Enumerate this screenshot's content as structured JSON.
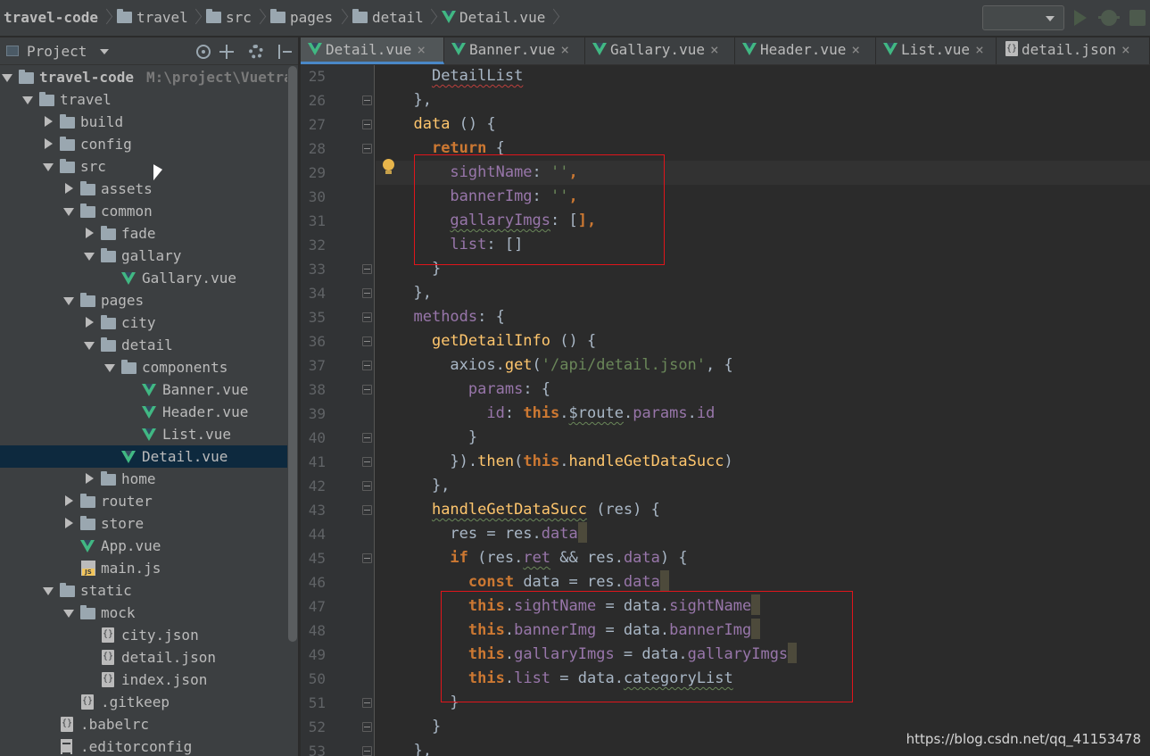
{
  "breadcrumb": [
    {
      "label": "travel-code",
      "icon": "none"
    },
    {
      "label": "travel",
      "icon": "folder-icon"
    },
    {
      "label": "src",
      "icon": "folder-icon"
    },
    {
      "label": "pages",
      "icon": "folder-icon"
    },
    {
      "label": "detail",
      "icon": "folder-icon"
    },
    {
      "label": "Detail.vue",
      "icon": "vue-icon"
    }
  ],
  "project": {
    "title": "Project",
    "tree": [
      {
        "label": "travel-code",
        "path": "M:\\project\\Vuetra",
        "depth": 0,
        "type": "folder",
        "open": true,
        "bold": true
      },
      {
        "label": "travel",
        "depth": 1,
        "type": "folder",
        "open": true
      },
      {
        "label": "build",
        "depth": 2,
        "type": "folder",
        "open": false
      },
      {
        "label": "config",
        "depth": 2,
        "type": "folder",
        "open": false
      },
      {
        "label": "src",
        "depth": 2,
        "type": "folder",
        "open": true
      },
      {
        "label": "assets",
        "depth": 3,
        "type": "folder",
        "open": false
      },
      {
        "label": "common",
        "depth": 3,
        "type": "folder",
        "open": true
      },
      {
        "label": "fade",
        "depth": 4,
        "type": "folder",
        "open": false
      },
      {
        "label": "gallary",
        "depth": 4,
        "type": "folder",
        "open": true
      },
      {
        "label": "Gallary.vue",
        "depth": 5,
        "type": "vue"
      },
      {
        "label": "pages",
        "depth": 3,
        "type": "folder",
        "open": true
      },
      {
        "label": "city",
        "depth": 4,
        "type": "folder",
        "open": false
      },
      {
        "label": "detail",
        "depth": 4,
        "type": "folder",
        "open": true
      },
      {
        "label": "components",
        "depth": 5,
        "type": "folder",
        "open": true
      },
      {
        "label": "Banner.vue",
        "depth": 6,
        "type": "vue"
      },
      {
        "label": "Header.vue",
        "depth": 6,
        "type": "vue"
      },
      {
        "label": "List.vue",
        "depth": 6,
        "type": "vue"
      },
      {
        "label": "Detail.vue",
        "depth": 5,
        "type": "vue",
        "selected": true
      },
      {
        "label": "home",
        "depth": 4,
        "type": "folder",
        "open": false
      },
      {
        "label": "router",
        "depth": 3,
        "type": "folder",
        "open": false
      },
      {
        "label": "store",
        "depth": 3,
        "type": "folder",
        "open": false
      },
      {
        "label": "App.vue",
        "depth": 3,
        "type": "vue"
      },
      {
        "label": "main.js",
        "depth": 3,
        "type": "js"
      },
      {
        "label": "static",
        "depth": 2,
        "type": "folder",
        "open": true
      },
      {
        "label": "mock",
        "depth": 3,
        "type": "folder",
        "open": true
      },
      {
        "label": "city.json",
        "depth": 4,
        "type": "json"
      },
      {
        "label": "detail.json",
        "depth": 4,
        "type": "json"
      },
      {
        "label": "index.json",
        "depth": 4,
        "type": "json"
      },
      {
        "label": ".gitkeep",
        "depth": 3,
        "type": "unknown"
      },
      {
        "label": ".babelrc",
        "depth": 2,
        "type": "json"
      },
      {
        "label": ".editorconfig",
        "depth": 2,
        "type": "config"
      }
    ]
  },
  "tabs": [
    {
      "label": "Detail.vue",
      "icon": "vue",
      "active": true
    },
    {
      "label": "Banner.vue",
      "icon": "vue"
    },
    {
      "label": "Gallary.vue",
      "icon": "vue"
    },
    {
      "label": "Header.vue",
      "icon": "vue"
    },
    {
      "label": "List.vue",
      "icon": "vue"
    },
    {
      "label": "detail.json",
      "icon": "json"
    }
  ],
  "tab_close_glyph": "×",
  "editor": {
    "lines": [
      {
        "n": "25",
        "tokens": [
          [
            "    ",
            ""
          ],
          [
            "DetailList",
            "wavy-red"
          ]
        ]
      },
      {
        "n": "26",
        "tokens": [
          [
            "  },",
            ""
          ]
        ]
      },
      {
        "n": "27",
        "tokens": [
          [
            "  ",
            ""
          ],
          [
            "data",
            "fn"
          ],
          [
            " () {",
            ""
          ]
        ]
      },
      {
        "n": "28",
        "tokens": [
          [
            "    ",
            ""
          ],
          [
            "return",
            "kw"
          ],
          [
            " {",
            ""
          ]
        ]
      },
      {
        "n": "29",
        "tokens": [
          [
            "      ",
            ""
          ],
          [
            "sightName",
            "prop"
          ],
          [
            ": ",
            ""
          ],
          [
            "''",
            "str"
          ],
          [
            ",",
            "kw"
          ]
        ]
      },
      {
        "n": "30",
        "tokens": [
          [
            "      ",
            ""
          ],
          [
            "bannerImg",
            "prop"
          ],
          [
            ": ",
            ""
          ],
          [
            "''",
            "str"
          ],
          [
            ",",
            "kw"
          ]
        ]
      },
      {
        "n": "31",
        "tokens": [
          [
            "      ",
            ""
          ],
          [
            "gallaryImgs",
            "prop wavy"
          ],
          [
            ": [",
            ""
          ],
          [
            "],",
            "kw"
          ]
        ]
      },
      {
        "n": "32",
        "tokens": [
          [
            "      ",
            ""
          ],
          [
            "list",
            "prop"
          ],
          [
            ": []",
            ""
          ]
        ]
      },
      {
        "n": "33",
        "tokens": [
          [
            "    }",
            ""
          ]
        ]
      },
      {
        "n": "34",
        "tokens": [
          [
            "  },",
            ""
          ]
        ]
      },
      {
        "n": "35",
        "tokens": [
          [
            "  ",
            ""
          ],
          [
            "methods",
            "prop"
          ],
          [
            ": {",
            ""
          ]
        ]
      },
      {
        "n": "36",
        "tokens": [
          [
            "    ",
            ""
          ],
          [
            "getDetailInfo",
            "fn"
          ],
          [
            " () {",
            ""
          ]
        ]
      },
      {
        "n": "37",
        "tokens": [
          [
            "      axios.",
            ""
          ],
          [
            "get",
            "fn"
          ],
          [
            "(",
            ""
          ],
          [
            "'/api/detail.json'",
            "str"
          ],
          [
            ", {",
            ""
          ]
        ]
      },
      {
        "n": "38",
        "tokens": [
          [
            "        ",
            ""
          ],
          [
            "params",
            "prop"
          ],
          [
            ": {",
            ""
          ]
        ]
      },
      {
        "n": "39",
        "tokens": [
          [
            "          ",
            ""
          ],
          [
            "id",
            "prop"
          ],
          [
            ": ",
            ""
          ],
          [
            "this",
            "kw"
          ],
          [
            ".",
            ""
          ],
          [
            "$route",
            "wavy"
          ],
          [
            ".",
            ""
          ],
          [
            "params",
            "prop"
          ],
          [
            ".",
            ""
          ],
          [
            "id",
            "prop"
          ]
        ]
      },
      {
        "n": "40",
        "tokens": [
          [
            "        }",
            ""
          ]
        ]
      },
      {
        "n": "41",
        "tokens": [
          [
            "      }).",
            ""
          ],
          [
            "then",
            "fn"
          ],
          [
            "(",
            ""
          ],
          [
            "this",
            "kw"
          ],
          [
            ".",
            ""
          ],
          [
            "handleGetDataSucc",
            "fn"
          ],
          [
            ")",
            ""
          ]
        ]
      },
      {
        "n": "42",
        "tokens": [
          [
            "    },",
            ""
          ]
        ]
      },
      {
        "n": "43",
        "tokens": [
          [
            "    ",
            ""
          ],
          [
            "handleGetDataSucc",
            "fn wavy"
          ],
          [
            " (res) {",
            ""
          ]
        ]
      },
      {
        "n": "44",
        "tokens": [
          [
            "      res = res.",
            ""
          ],
          [
            "data",
            "prop"
          ],
          [
            "",
            "hl-end"
          ]
        ]
      },
      {
        "n": "45",
        "tokens": [
          [
            "      ",
            ""
          ],
          [
            "if",
            "kw"
          ],
          [
            " (res.",
            ""
          ],
          [
            "ret",
            "prop wavy"
          ],
          [
            " && res.",
            ""
          ],
          [
            "data",
            "prop"
          ],
          [
            ") {",
            ""
          ]
        ]
      },
      {
        "n": "46",
        "tokens": [
          [
            "        ",
            ""
          ],
          [
            "const",
            "kw"
          ],
          [
            " data = res.",
            ""
          ],
          [
            "data",
            "prop"
          ],
          [
            "",
            "hl-end"
          ]
        ]
      },
      {
        "n": "47",
        "tokens": [
          [
            "        ",
            ""
          ],
          [
            "this",
            "kw"
          ],
          [
            ".",
            ""
          ],
          [
            "sightName",
            "prop"
          ],
          [
            " = data.",
            ""
          ],
          [
            "sightName",
            "prop"
          ],
          [
            "",
            "hl-end"
          ]
        ]
      },
      {
        "n": "48",
        "tokens": [
          [
            "        ",
            ""
          ],
          [
            "this",
            "kw"
          ],
          [
            ".",
            ""
          ],
          [
            "bannerImg",
            "prop"
          ],
          [
            " = data.",
            ""
          ],
          [
            "bannerImg",
            "prop"
          ],
          [
            "",
            "hl-end"
          ]
        ]
      },
      {
        "n": "49",
        "tokens": [
          [
            "        ",
            ""
          ],
          [
            "this",
            "kw"
          ],
          [
            ".",
            ""
          ],
          [
            "gallaryImgs",
            "prop"
          ],
          [
            " = data.",
            ""
          ],
          [
            "gallaryImgs",
            "prop"
          ],
          [
            "",
            "hl-end"
          ]
        ]
      },
      {
        "n": "50",
        "tokens": [
          [
            "        ",
            ""
          ],
          [
            "this",
            "kw"
          ],
          [
            ".",
            ""
          ],
          [
            "list",
            "prop"
          ],
          [
            " = data.",
            ""
          ],
          [
            "categoryList",
            "wavy"
          ]
        ]
      },
      {
        "n": "51",
        "tokens": [
          [
            "      }",
            ""
          ]
        ]
      },
      {
        "n": "52",
        "tokens": [
          [
            "    }",
            ""
          ]
        ]
      },
      {
        "n": "53",
        "tokens": [
          [
            "  },",
            ""
          ]
        ]
      }
    ]
  },
  "watermark": "https://blog.csdn.net/qq_41153478",
  "colors": {
    "accent": "#4a88c7",
    "vue": "#41b883",
    "highlight_box": "#e0151b"
  }
}
